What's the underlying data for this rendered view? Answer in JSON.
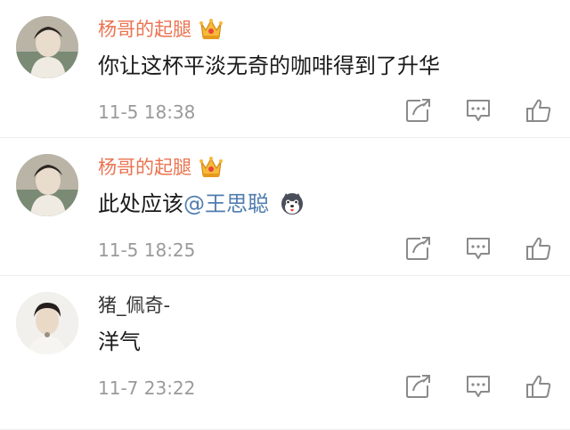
{
  "comments": [
    {
      "username": "杨哥的起腿",
      "vip": true,
      "content_prefix": "你让这杯平淡无奇的咖啡得到了升华",
      "mention": "",
      "has_emoji": false,
      "time": "11-5 18:38"
    },
    {
      "username": "杨哥的起腿",
      "vip": true,
      "content_prefix": "此处应该",
      "mention": "@王思聪",
      "has_emoji": true,
      "time": "11-5 18:25"
    },
    {
      "username": "猪_佩奇-",
      "vip": false,
      "content_prefix": "洋气",
      "mention": "",
      "has_emoji": false,
      "time": "11-7 23:22"
    }
  ],
  "colors": {
    "vip_name": "#eb7350",
    "mention": "#507daf",
    "time": "#9a9a9a",
    "icon": "#8a8a8a"
  },
  "icons": {
    "badge": "crown-icon",
    "emoji": "husky-dog-emoji-icon",
    "share": "share-icon",
    "comment": "comment-icon",
    "like": "thumbs-up-icon"
  }
}
